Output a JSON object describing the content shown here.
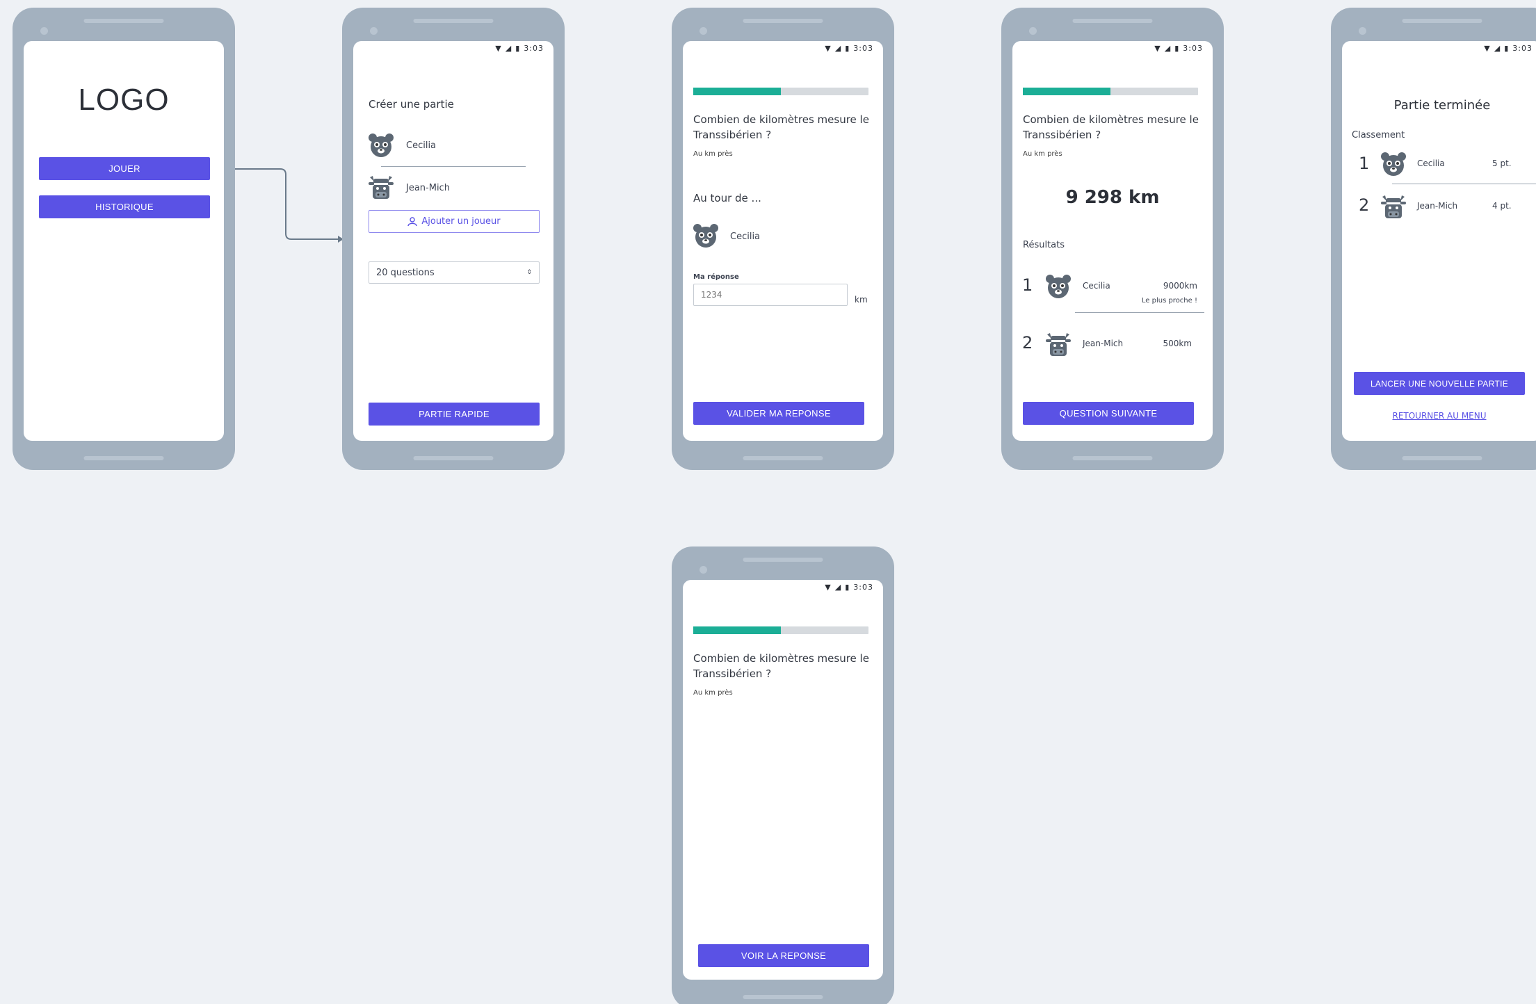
{
  "status": {
    "time": "3:03"
  },
  "screen1": {
    "logo": "LOGO",
    "play": "JOUER",
    "history": "HISTORIQUE"
  },
  "screen2": {
    "title": "Créer une partie",
    "players": [
      "Cecilia",
      "Jean-Mich"
    ],
    "add_player": "Ajouter un joueur",
    "questions_select": "20 questions",
    "quick_game": "PARTIE RAPIDE"
  },
  "question": {
    "text": "Combien de kilomètres mesure le Transsibérien ?",
    "hint": "Au km près",
    "progress": 0.5
  },
  "screen3": {
    "turn_label": "Au tour de ...",
    "player": "Cecilia",
    "answer_label": "Ma réponse",
    "answer_placeholder": "1234",
    "unit": "km",
    "validate": "VALIDER MA REPONSE"
  },
  "screen4": {
    "answer": "9 298 km",
    "results_label": "Résultats",
    "results": [
      {
        "rank": "1",
        "name": "Cecilia",
        "value": "9000km",
        "note": "Le plus proche !"
      },
      {
        "rank": "2",
        "name": "Jean-Mich",
        "value": "500km"
      }
    ],
    "next": "QUESTION SUIVANTE"
  },
  "screen5": {
    "title": "Partie terminée",
    "ranking_label": "Classement",
    "ranking": [
      {
        "rank": "1",
        "name": "Cecilia",
        "points": "5 pt."
      },
      {
        "rank": "2",
        "name": "Jean-Mich",
        "points": "4 pt."
      }
    ],
    "new_game": "LANCER UNE NOUVELLE PARTIE",
    "back_menu": "RETOURNER AU MENU"
  },
  "screen6": {
    "see_answer": "VOIR LA REPONSE"
  },
  "colors": {
    "accent": "#5a52e5",
    "progress": "#1bae96",
    "phone": "#a3b1bf",
    "background": "#eef1f5"
  },
  "icons": {
    "bear": "bear-avatar-icon",
    "cow": "cow-avatar-icon"
  }
}
